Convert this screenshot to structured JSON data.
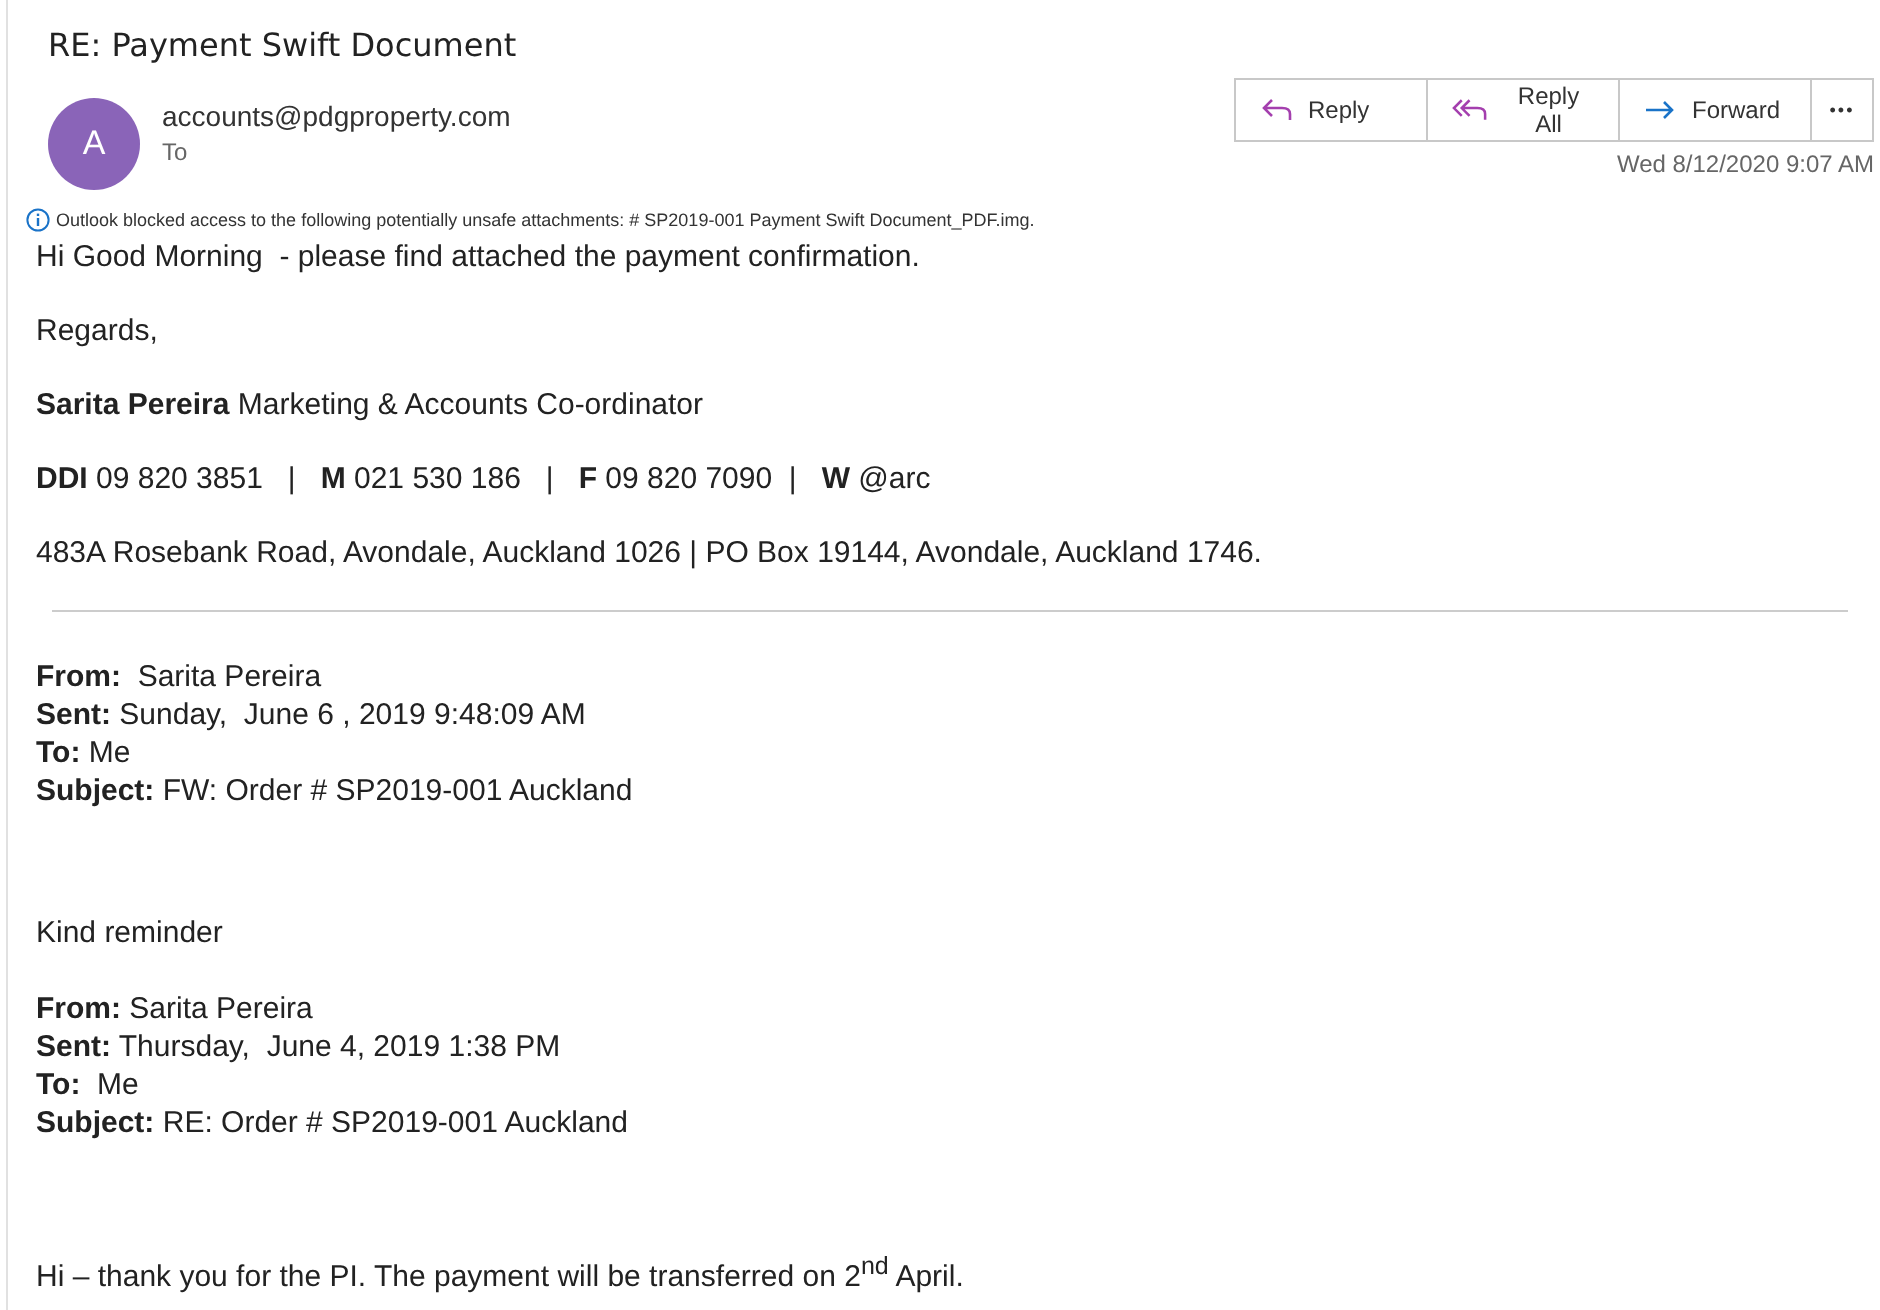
{
  "subject": "RE: Payment Swift Document",
  "sender": {
    "initial": "A",
    "address": "accounts@pdgproperty.com",
    "to_label": "To"
  },
  "actions": [
    {
      "kind": "reply",
      "label": "Reply"
    },
    {
      "kind": "reply_all",
      "label": "Reply All"
    },
    {
      "kind": "forward",
      "label": "Forward"
    },
    {
      "kind": "more",
      "label": "•••"
    }
  ],
  "date": "Wed 8/12/2020 9:07 AM",
  "notice": "Outlook blocked access to the following potentially unsafe attachments: # SP2019-001 Payment Swift Document_PDF.img.",
  "body": [
    "Hi Good Morning  - please find attached the payment confirmation.",
    "Regards,",
    "**Sarita Pereira** Marketing & Accounts Co-ordinator",
    "**DDI** 09 820 3851   |   **M** 021 530 186   |   **F** 09 820 7090  |   **W** @arc",
    "483A Rosebank Road, Avondale, Auckland 1026 | PO Box 19144, Avondale, Auckland 1746."
  ],
  "quoted": [
    {
      "kind": "header",
      "lines": [
        "**From:**  Sarita Pereira",
        "**Sent:** Sunday,  June 6 , 2019 9:48:09 AM",
        "**To:** Me",
        "**Subject:** FW: Order # SP2019-001 Auckland"
      ]
    },
    {
      "kind": "text",
      "text": "Kind reminder"
    },
    {
      "kind": "header",
      "lines": [
        "**From:** Sarita Pereira",
        "**Sent:** Thursday,  June 4, 2019 1:38 PM",
        "**To:**  Me",
        "**Subject:** RE: Order # SP2019-001 Auckland"
      ]
    },
    {
      "kind": "text",
      "text": "Hi – thank you for the PI. The payment will be transferred on 2$^{nd}$ April."
    }
  ]
}
